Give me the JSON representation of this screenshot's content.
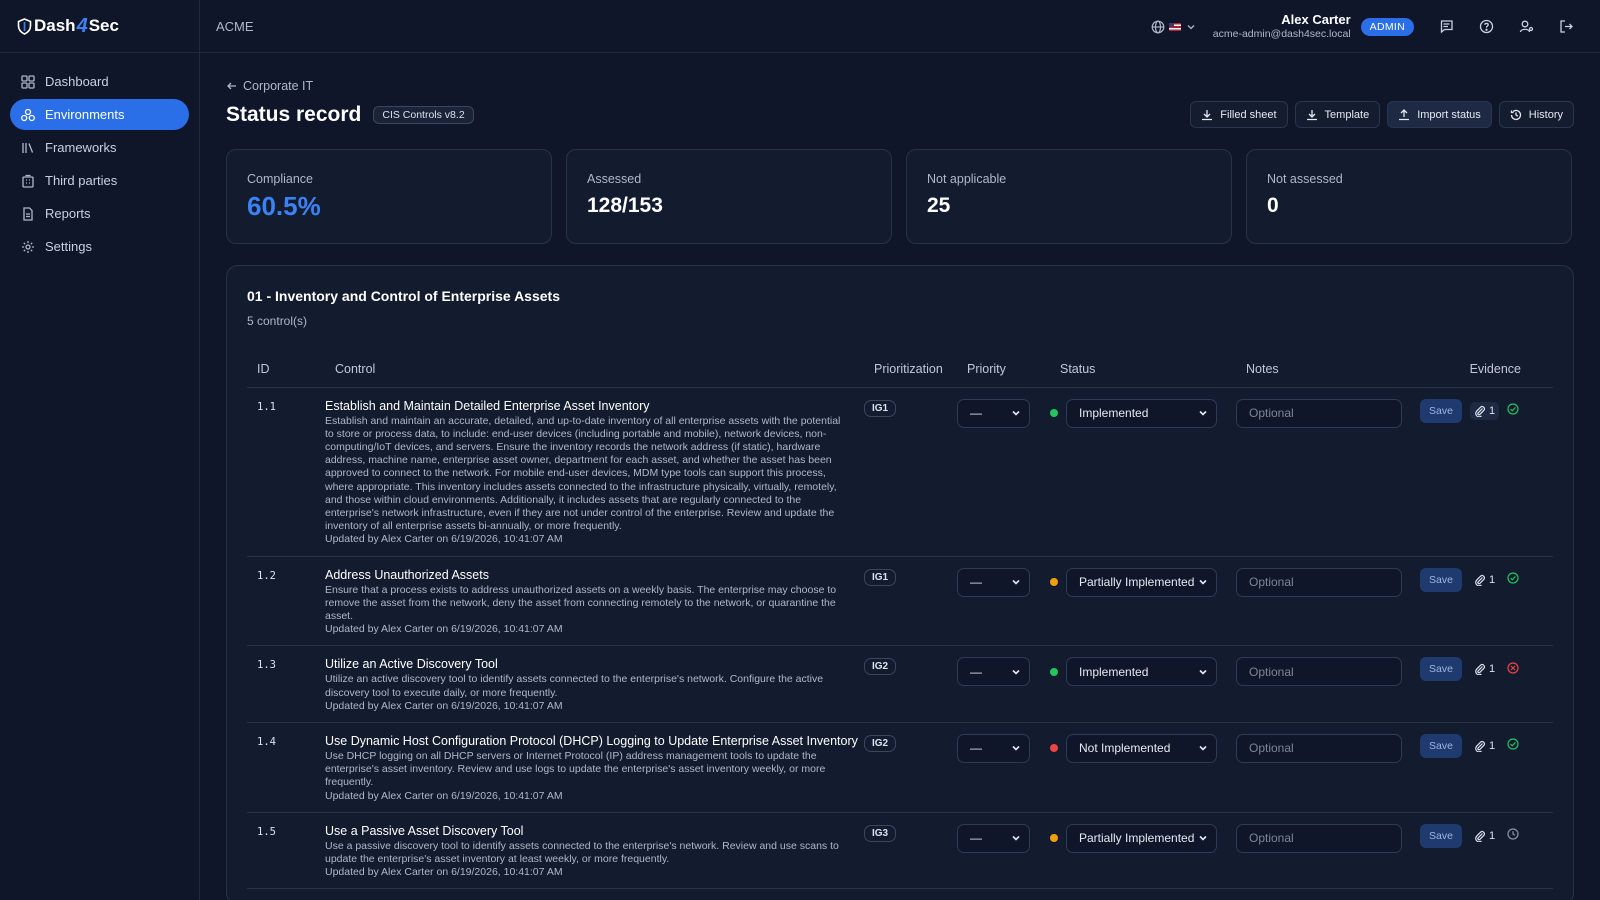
{
  "app": {
    "name": "Dash4Sec",
    "name_prefix": "Dash",
    "name_four": "4",
    "name_suffix": "Sec"
  },
  "sidebar": {
    "items": [
      {
        "label": "Dashboard",
        "icon": "dashboard-icon",
        "active": false
      },
      {
        "label": "Environments",
        "icon": "environments-icon",
        "active": true
      },
      {
        "label": "Frameworks",
        "icon": "frameworks-icon",
        "active": false
      },
      {
        "label": "Third parties",
        "icon": "building-icon",
        "active": false
      },
      {
        "label": "Reports",
        "icon": "document-icon",
        "active": false
      },
      {
        "label": "Settings",
        "icon": "gear-icon",
        "active": false
      }
    ]
  },
  "topbar": {
    "org": "ACME",
    "language": "en-US",
    "user_name": "Alex Carter",
    "user_email": "acme-admin@dash4sec.local",
    "role": "ADMIN"
  },
  "page": {
    "back_label": "Corporate IT",
    "title": "Status record",
    "framework": "CIS Controls v8.2",
    "actions": {
      "filled_sheet": "Filled sheet",
      "template": "Template",
      "import_status": "Import status",
      "history": "History"
    }
  },
  "stats": {
    "compliance_label": "Compliance",
    "compliance_value": "60.5%",
    "assessed_label": "Assessed",
    "assessed_value": "128/153",
    "na_label": "Not applicable",
    "na_value": "25",
    "not_assessed_label": "Not assessed",
    "not_assessed_value": "0"
  },
  "section": {
    "title": "01 - Inventory and Control of Enterprise Assets",
    "subtitle": "5 control(s)",
    "columns": {
      "id": "ID",
      "control": "Control",
      "prioritization": "Prioritization",
      "priority": "Priority",
      "status": "Status",
      "notes": "Notes",
      "evidence": "Evidence"
    },
    "notes_placeholder": "Optional",
    "save_label": "Save",
    "priority_value": "—",
    "rows": [
      {
        "id": "1.1",
        "title": "Establish and Maintain Detailed Enterprise Asset Inventory",
        "description": "Establish and maintain an accurate, detailed, and up-to-date inventory of all enterprise assets with the potential to store or process data, to include: end-user devices (including portable and mobile), network devices, non-computing/IoT devices, and servers. Ensure the inventory records the network address (if static), hardware address, machine name, enterprise asset owner, department for each asset, and whether the asset has been approved to connect to the network. For mobile end-user devices, MDM type tools can support this process, where appropriate. This inventory includes assets connected to the infrastructure physically, virtually, remotely, and those within cloud environments. Additionally, it includes assets that are regularly connected to the enterprise's network infrastructure, even if they are not under control of the enterprise. Review and update the inventory of all enterprise assets bi-annually, or more frequently.",
        "updated": "Updated by Alex Carter on 6/19/2026, 10:41:07 AM",
        "ig": "IG1",
        "status": "Implemented",
        "status_color": "#22c55e",
        "evidence_count": "1",
        "evidence_state": "check-circle-icon"
      },
      {
        "id": "1.2",
        "title": "Address Unauthorized Assets",
        "description": "Ensure that a process exists to address unauthorized assets on a weekly basis. The enterprise may choose to remove the asset from the network, deny the asset from connecting remotely to the network, or quarantine the asset.",
        "updated": "Updated by Alex Carter on 6/19/2026, 10:41:07 AM",
        "ig": "IG1",
        "status": "Partially Implemented",
        "status_color": "#f59e0b",
        "evidence_count": "1",
        "evidence_state": "check-circle-icon"
      },
      {
        "id": "1.3",
        "title": "Utilize an Active Discovery Tool",
        "description": "Utilize an active discovery tool to identify assets connected to the enterprise's network. Configure the active discovery tool to execute daily, or more frequently.",
        "updated": "Updated by Alex Carter on 6/19/2026, 10:41:07 AM",
        "ig": "IG2",
        "status": "Implemented",
        "status_color": "#22c55e",
        "evidence_count": "1",
        "evidence_state": "x-circle-icon"
      },
      {
        "id": "1.4",
        "title": "Use Dynamic Host Configuration Protocol (DHCP) Logging to Update Enterprise Asset Inventory",
        "description": "Use DHCP logging on all DHCP servers or Internet Protocol (IP) address management tools to update the enterprise's asset inventory. Review and use logs to update the enterprise's asset inventory weekly, or more frequently.",
        "updated": "Updated by Alex Carter on 6/19/2026, 10:41:07 AM",
        "ig": "IG2",
        "status": "Not Implemented",
        "status_color": "#ef4444",
        "evidence_count": "1",
        "evidence_state": "check-circle-icon"
      },
      {
        "id": "1.5",
        "title": "Use a Passive Asset Discovery Tool",
        "description": "Use a passive discovery tool to identify assets connected to the enterprise's network. Review and use scans to update the enterprise's asset inventory at least weekly, or more frequently.",
        "updated": "Updated by Alex Carter on 6/19/2026, 10:41:07 AM",
        "ig": "IG3",
        "status": "Partially Implemented",
        "status_color": "#f59e0b",
        "evidence_count": "1",
        "evidence_state": "clock-icon"
      }
    ]
  },
  "colors": {
    "accent": "#2a6ee8",
    "background": "#0f1629",
    "card": "#131b2e",
    "success": "#22c55e",
    "warning": "#f59e0b",
    "danger": "#ef4444"
  }
}
